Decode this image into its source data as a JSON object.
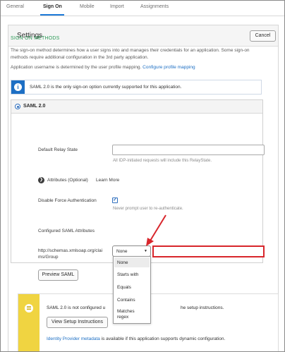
{
  "tabs": [
    {
      "label": "General"
    },
    {
      "label": "Sign On"
    },
    {
      "label": "Mobile"
    },
    {
      "label": "Import"
    },
    {
      "label": "Assignments"
    }
  ],
  "panel": {
    "title": "Settings",
    "cancel_label": "Cancel"
  },
  "sign_on_methods": {
    "heading": "SIGN ON METHODS",
    "description": "The sign-on method determines how a user signs into and manages their credentials for an application. Some sign-on methods require additional configuration in the 3rd party application.",
    "username_text": "Application username is determined by the user profile mapping.",
    "username_link": "Configure profile mapping"
  },
  "info_banner": {
    "icon": "info-icon",
    "text": "SAML 2.0 is the only sign-on option currently supported for this application."
  },
  "saml": {
    "option_label": "SAML 2.0",
    "relay_state": {
      "label": "Default Relay State",
      "value": "",
      "hint": "All IDP-initiated requests will include this RelayState."
    },
    "attributes": {
      "label": "Attributes (Optional)",
      "link": "Learn More"
    },
    "disable_force_auth": {
      "label": "Disable Force Authentication",
      "checked": true,
      "hint": "Never prompt user to re-authenticate."
    },
    "configured_attributes_label": "Configured SAML Attributes",
    "attribute_row": {
      "name_line1": "http://schemas.xmlsoap.org/clai",
      "name_line2": "ms/Group",
      "filter_selected": "None",
      "filter_options": [
        "None",
        "Starts with",
        "Equals",
        "Contains",
        "Matches",
        "regex"
      ],
      "value": ""
    },
    "preview_label": "Preview SAML"
  },
  "warning_banner": {
    "text_start": "SAML 2.0 is not configured u",
    "text_end": "he setup instructions.",
    "button_label": "View Setup Instructions",
    "footer_link": "Identity Provider metadata",
    "footer_text": " is available if this application supports dynamic configuration."
  },
  "colors": {
    "accent_blue": "#1d6fc4",
    "section_green": "#2a9a56",
    "warning_yellow": "#f0d441",
    "highlight_red": "#d8262c"
  }
}
